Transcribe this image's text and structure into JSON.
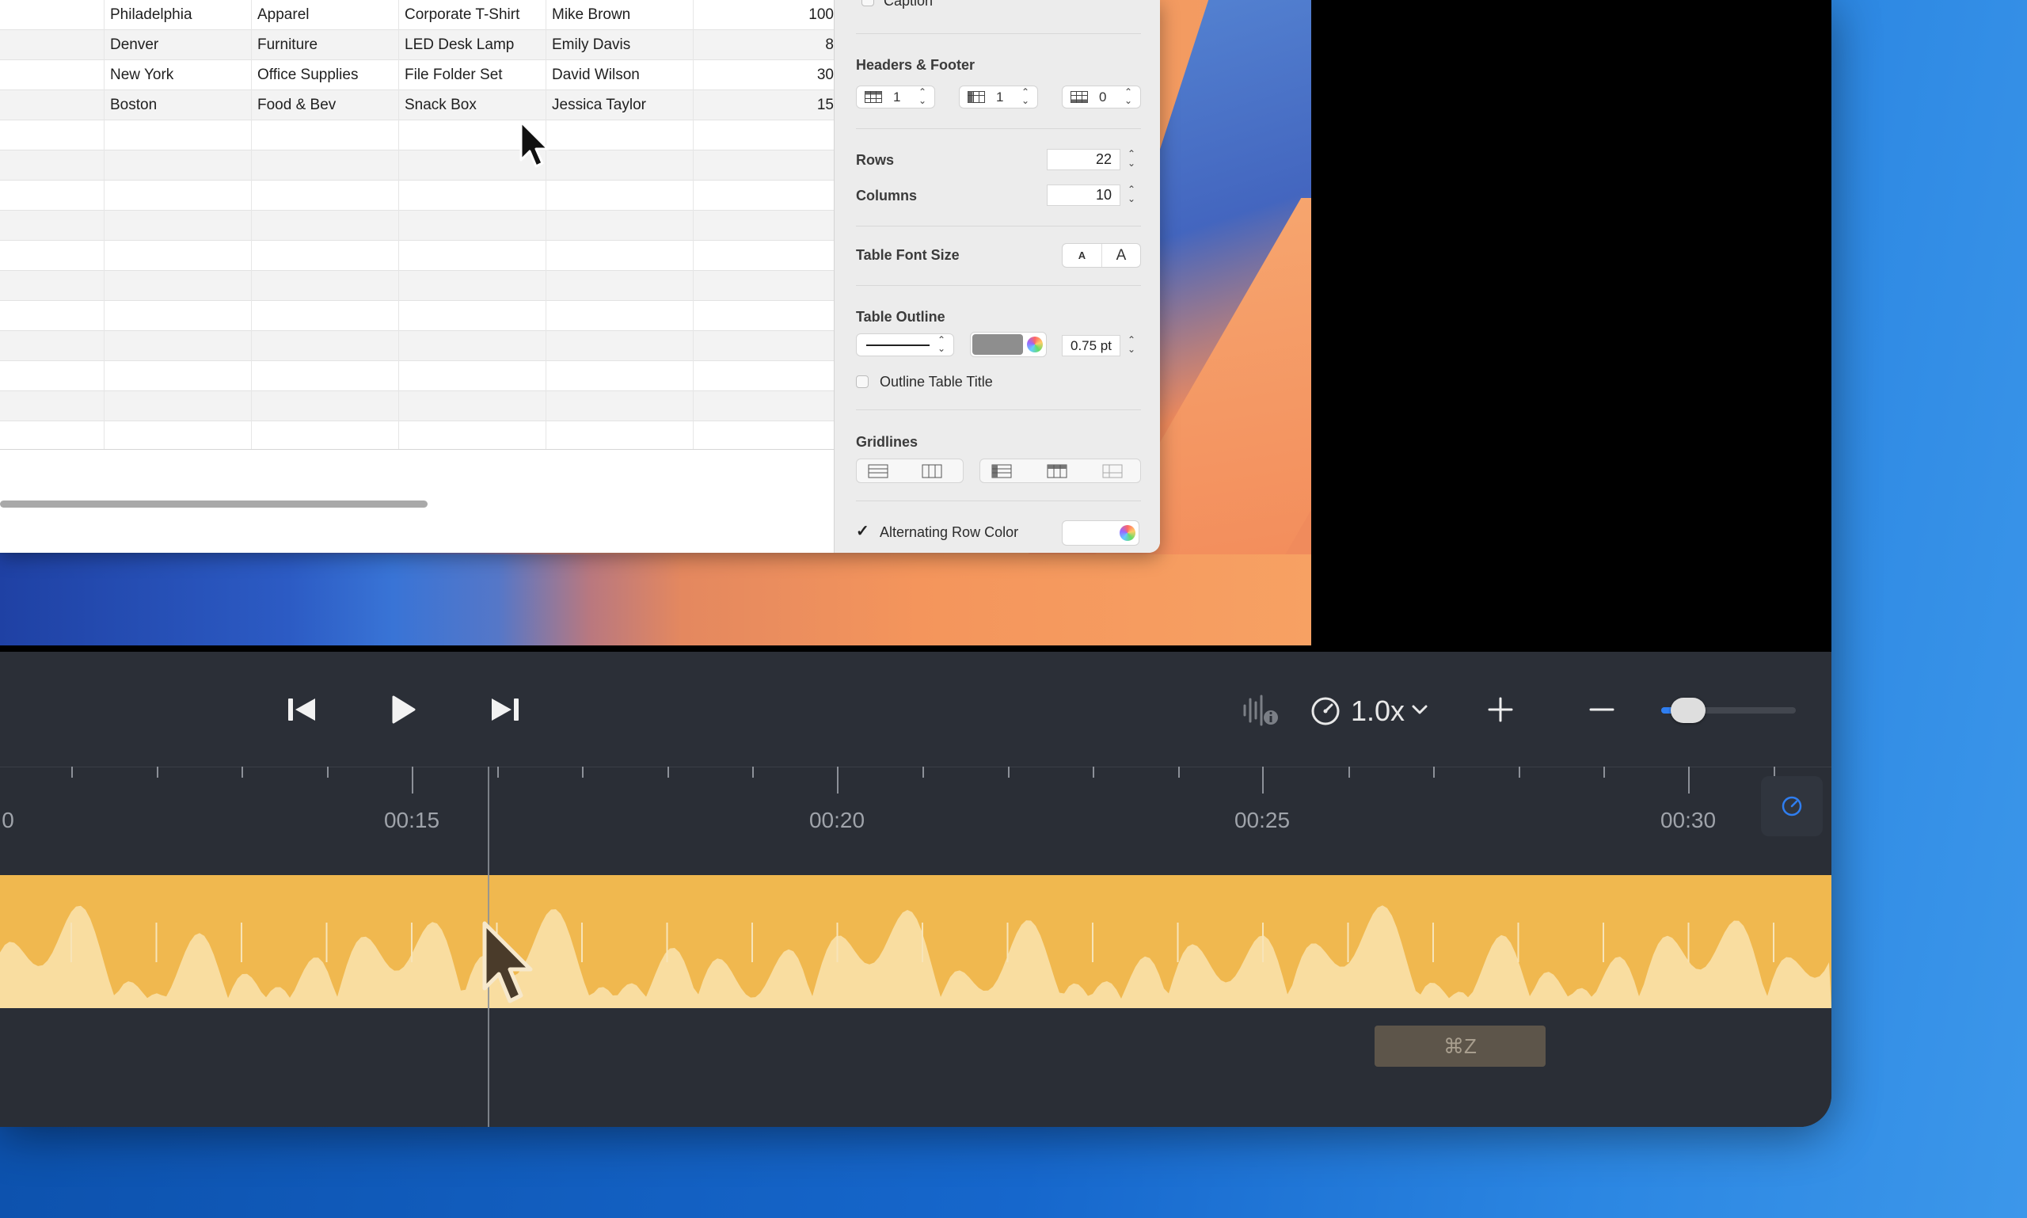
{
  "table": {
    "rows": [
      {
        "city": "Philadelphia",
        "category": "Apparel",
        "product": "Corporate T-Shirt",
        "rep": "Mike Brown",
        "qty": "100"
      },
      {
        "city": "Denver",
        "category": "Furniture",
        "product": "LED Desk Lamp",
        "rep": "Emily Davis",
        "qty": "8"
      },
      {
        "city": "New York",
        "category": "Office Supplies",
        "product": "File Folder Set",
        "rep": "David Wilson",
        "qty": "30"
      },
      {
        "city": "Boston",
        "category": "Food & Bev",
        "product": "Snack Box",
        "rep": "Jessica Taylor",
        "qty": "15"
      }
    ]
  },
  "inspector": {
    "caption_label": "Caption",
    "headers_footer_label": "Headers & Footer",
    "header_rows": "1",
    "header_columns": "1",
    "footer_rows": "0",
    "rows_label": "Rows",
    "rows_value": "22",
    "columns_label": "Columns",
    "columns_value": "10",
    "font_size_label": "Table Font Size",
    "font_smaller": "A",
    "font_larger": "A",
    "outline_label": "Table Outline",
    "outline_width": "0.75 pt",
    "outline_color": "#8e8e8e",
    "outline_title_label": "Outline Table Title",
    "gridlines_label": "Gridlines",
    "alternating_label": "Alternating Row Color",
    "alternating_checked": true,
    "check_glyph": "✓"
  },
  "player": {
    "speed": "1.0x",
    "zoom_level": 0.2,
    "accent": "#2f7ef0"
  },
  "timeline": {
    "labels": [
      "0",
      "00:15",
      "00:20",
      "00:25",
      "00:30"
    ],
    "track_color": "#f0b84f",
    "shortcut": "⌘Z"
  }
}
